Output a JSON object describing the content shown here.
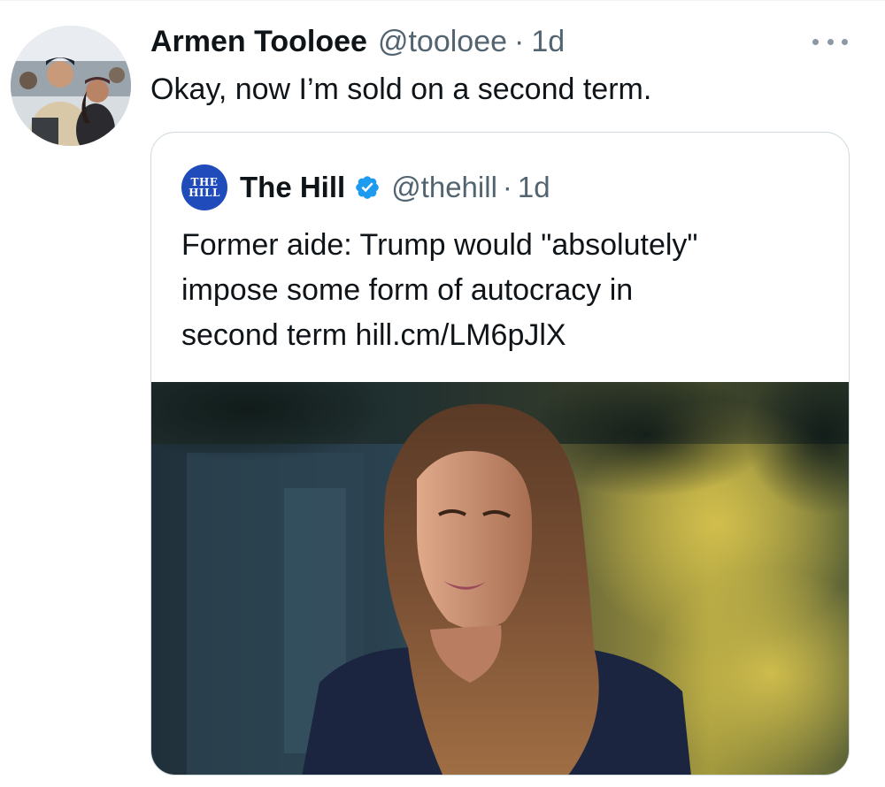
{
  "tweet": {
    "author_name": "Armen Tooloee",
    "author_handle": "@tooloee",
    "separator": "·",
    "time": "1d",
    "text": "Okay, now I’m sold on a second term.",
    "more_icon": "more-horizontal-icon",
    "avatar": "profile-photo"
  },
  "quote": {
    "logo_lines": [
      "THE",
      "HILL"
    ],
    "author_name": "The Hill",
    "verified_icon": "verified-badge-icon",
    "author_handle": "@thehill",
    "separator": "·",
    "time": "1d",
    "text_lines": [
      "Former aide: Trump would \"absolutely\"",
      "impose some form of autocracy in",
      "second term hill.cm/LM6pJlX"
    ],
    "media": "news-photo"
  },
  "colors": {
    "text_primary": "#0f1419",
    "text_secondary": "#536471",
    "border": "#cfd9de",
    "verified_blue": "#1d9bf0",
    "hill_blue": "#1f4bbb"
  }
}
